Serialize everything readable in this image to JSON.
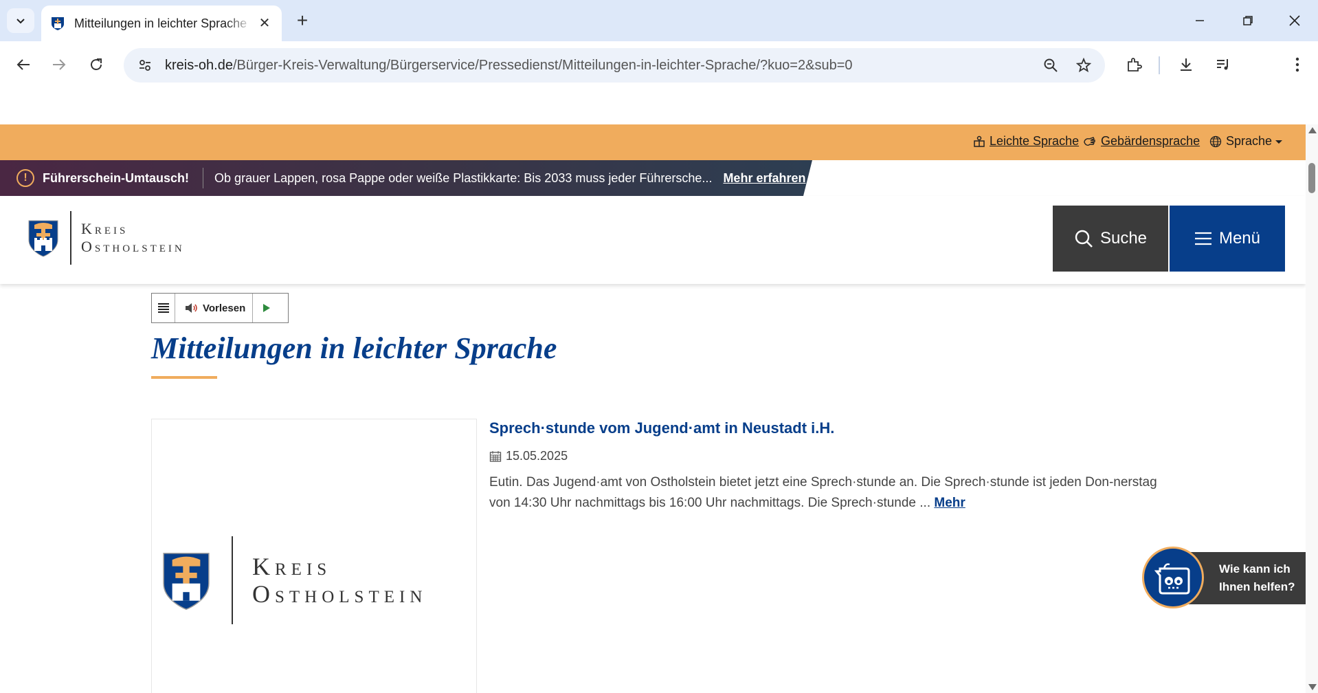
{
  "browser": {
    "tab_title": "Mitteilungen in leichter Sprache",
    "url_host": "kreis-oh.de",
    "url_path": "/Bürger-Kreis-Verwaltung/Bürgerservice/Pressedienst/Mitteilungen-in-leichter-Sprache/?kuo=2&sub=0"
  },
  "access_bar": {
    "easy_language": "Leichte Sprache",
    "sign_language": "Gebärdensprache",
    "language": "Sprache"
  },
  "alert": {
    "title": "Führerschein-Umtausch!",
    "text": "Ob grauer Lappen, rosa Pappe oder weiße Plastikkarte: Bis 2033 muss jeder Führersche...",
    "more": "Mehr erfahren"
  },
  "header": {
    "logo_line1": "Kreis",
    "logo_line2": "Ostholstein",
    "search": "Suche",
    "menu": "Menü"
  },
  "readspeaker": {
    "read_label": "Vorlesen"
  },
  "main": {
    "title": "Mitteilungen in leichter Sprache",
    "article": {
      "title": "Sprech·stunde vom Jugend·amt in Neustadt i.H.",
      "date": "15.05.2025",
      "text": "Eutin. Das Jugend·amt von Ostholstein bietet jetzt eine Sprech·stunde an. Die Sprech·stunde ist jeden Don-nerstag von 14:30 Uhr nachmittags bis 16:00 Uhr nachmittags. Die Sprech·stunde ... ",
      "more": "Mehr"
    }
  },
  "chatbot": {
    "line1": "Wie kann ich",
    "line2": "Ihnen helfen?"
  },
  "colors": {
    "brand_blue": "#073e8a",
    "accent_orange": "#f0ac5d",
    "dark_gray": "#3b3b3b"
  }
}
